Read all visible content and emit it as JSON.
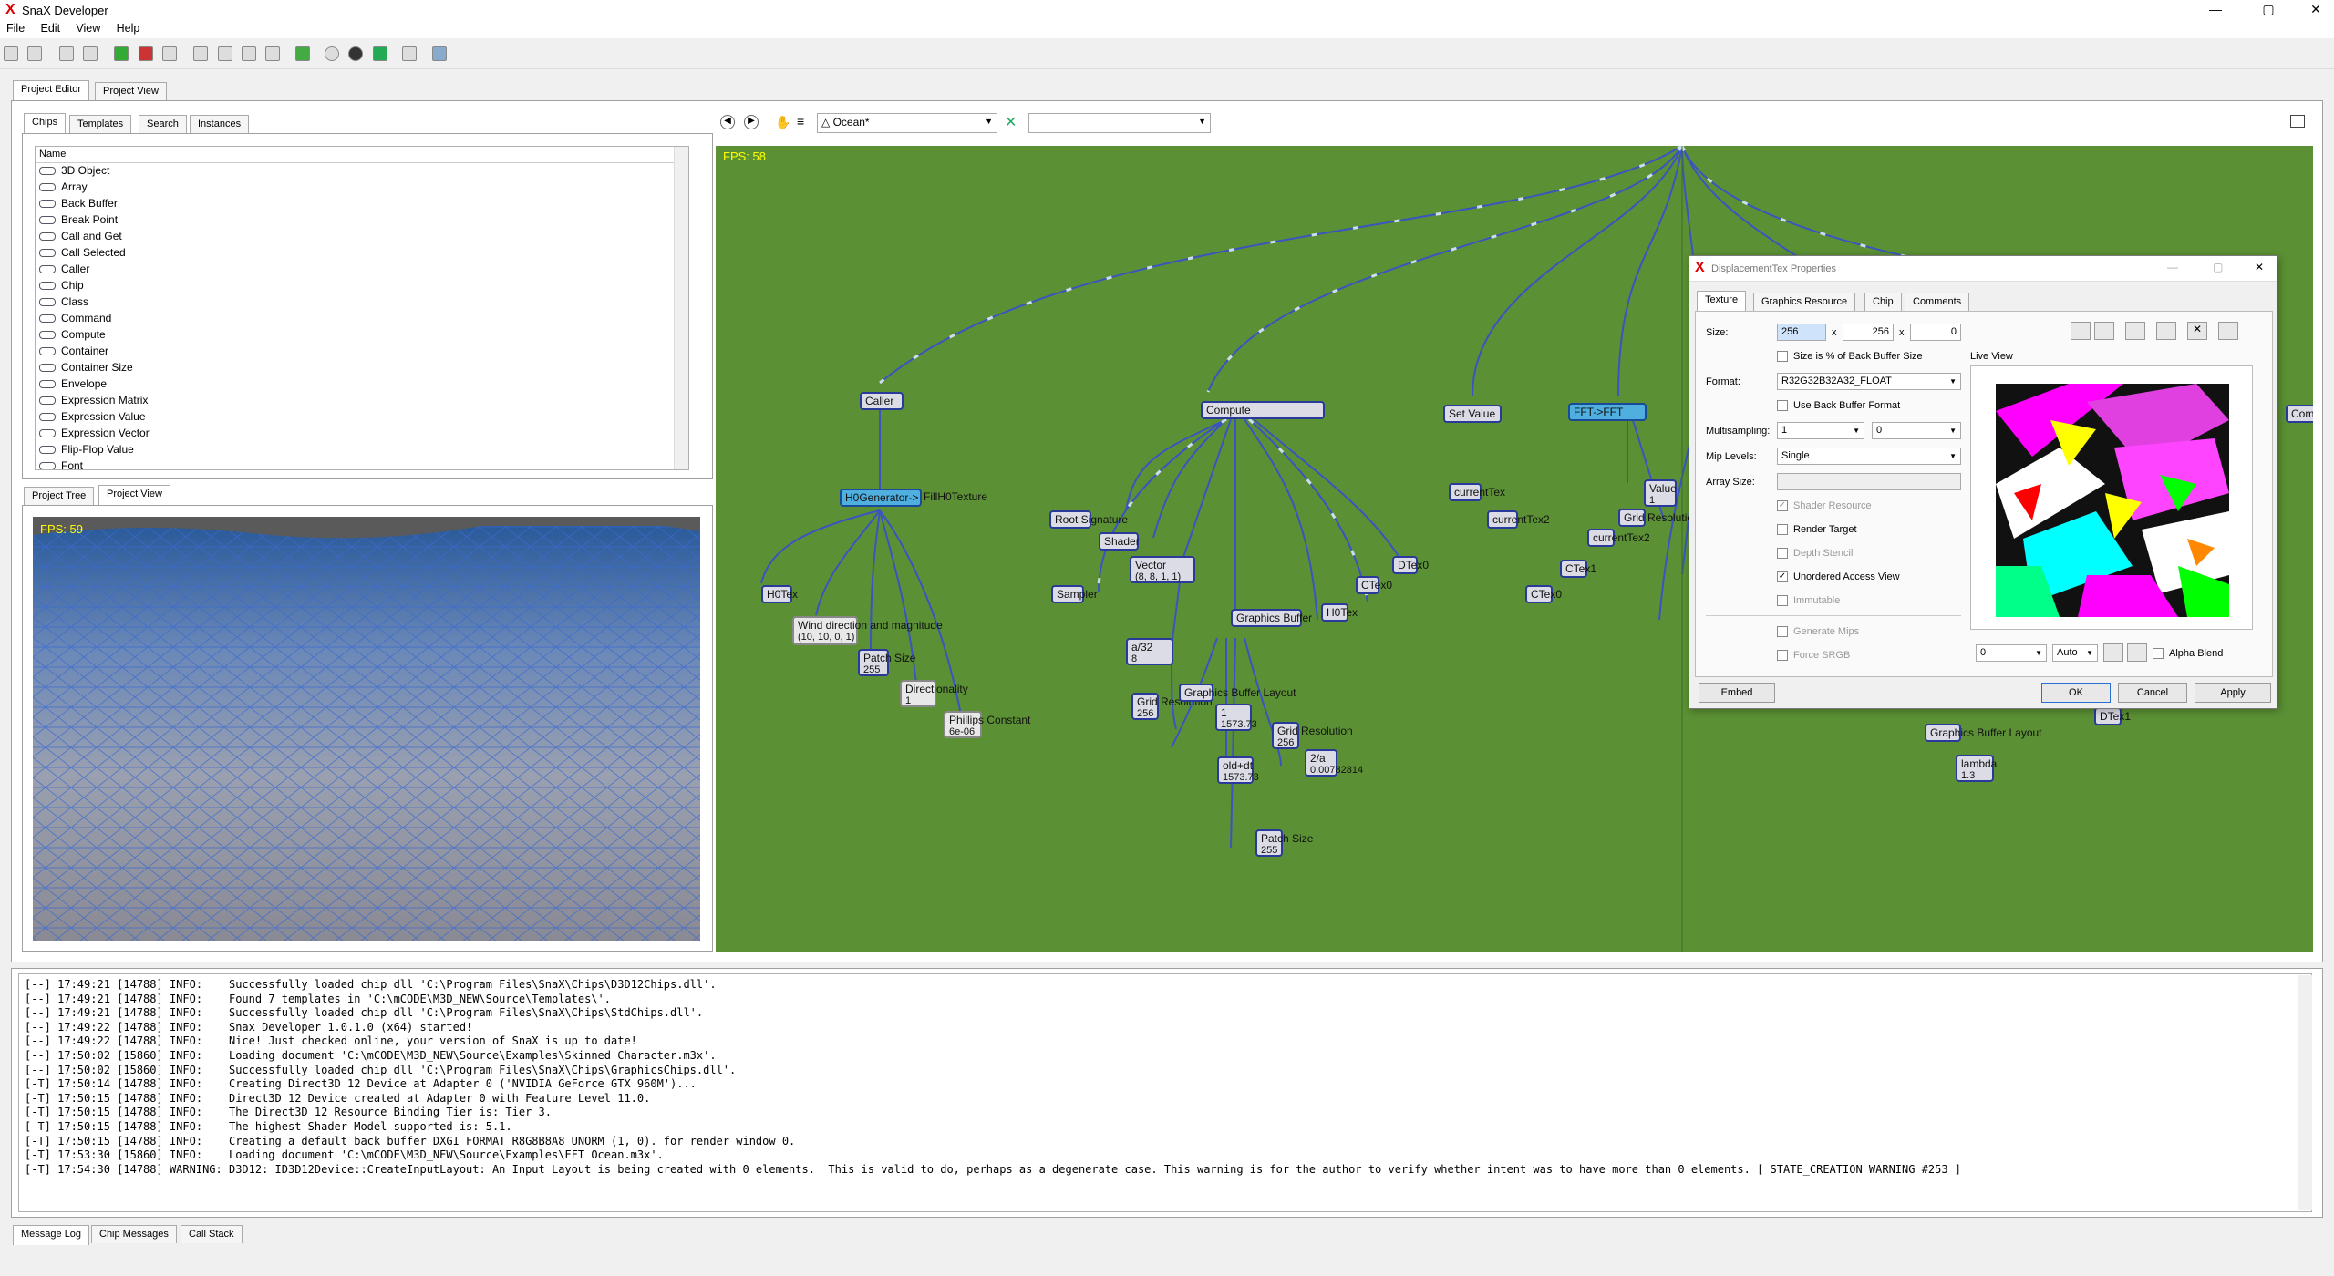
{
  "app": {
    "title": "SnaX Developer",
    "window_controls": [
      "—",
      "▢",
      "✕"
    ]
  },
  "menu": [
    "File",
    "Edit",
    "View",
    "Help"
  ],
  "main_tabs": [
    "Project Editor",
    "Project View"
  ],
  "chip_tabs": [
    "Chips",
    "Templates",
    "Search",
    "Instances"
  ],
  "chip_list": {
    "header": "Name",
    "items": [
      "3D Object",
      "Array",
      "Back Buffer",
      "Break Point",
      "Call and Get",
      "Call Selected",
      "Caller",
      "Chip",
      "Class",
      "Command",
      "Compute",
      "Container",
      "Container Size",
      "Envelope",
      "Expression Matrix",
      "Expression Value",
      "Expression Vector",
      "Flip-Flop Value",
      "Font"
    ]
  },
  "view_tabs": [
    "Project Tree",
    "Project View"
  ],
  "viewport_fps": "FPS: 59",
  "editor": {
    "document": "Ocean*",
    "second_combo": "",
    "fps": "FPS: 58"
  },
  "nodes": {
    "caller": "Caller",
    "compute": "Compute",
    "set_value": "Set Value",
    "fft": "FFT->FFT",
    "h0gen": "H0Generator->",
    "fill": "FillH0Texture",
    "h0tex": "H0Tex",
    "wind": "Wind direction and magnitude",
    "wind_val": "(10, 10, 0, 1)",
    "patch_size": "Patch Size",
    "patch_val": "255",
    "directionality": "Directionality",
    "dir_val": "1",
    "phillips": "Phillips Constant",
    "phillips_val": "6e-06",
    "root_sig": "Root Signature",
    "shader": "Shader",
    "sampler": "Sampler",
    "vector": "Vector",
    "vector_val": "(8, 8, 1, 1)",
    "a32": "a/32",
    "a32_val": "8",
    "grid_res": "Grid Resolution",
    "grid_val": "256",
    "gb_layout": "Graphics Buffer Layout",
    "graphics_buffer": "Graphics Buffer",
    "h0tex2": "H0Tex",
    "ctex0": "CTex0",
    "dtex0": "DTex0",
    "one": "1",
    "one_val": "1573.73",
    "old_dt": "old+dt",
    "old_dt_val": "1573.73",
    "grid_res2": "Grid Resolution",
    "grid_val2": "256",
    "two_a": "2/a",
    "two_a_val": "0.00782814",
    "patch2": "Patch Size",
    "patch2_val": "255",
    "current_tex": "currentTex",
    "current_tex2": "currentTex2",
    "ctex1": "CTex1",
    "ctex0b": "CTex0",
    "grid_res3": "Grid Resolution",
    "current_tex2b": "currentTex2",
    "value": "Value",
    "value_val": "1",
    "gb_layout2": "Graphics Buffer Layout",
    "lambda": "lambda",
    "lambda_val": "1.3",
    "dtex1": "DTex1",
    "com": "Com"
  },
  "dialog": {
    "title": "DisplacementTex Properties",
    "tabs": [
      "Texture",
      "Graphics Resource",
      "Chip",
      "Comments"
    ],
    "size_label": "Size:",
    "size_w": "256",
    "size_h": "256",
    "size_d": "0",
    "x": "x",
    "size_pct": "Size is % of Back Buffer Size",
    "format_label": "Format:",
    "format": "R32G32B32A32_FLOAT",
    "use_bb_format": "Use Back Buffer Format",
    "ms_label": "Multisampling:",
    "ms_count": "1",
    "ms_quality": "0",
    "mip_label": "Mip Levels:",
    "mip": "Single",
    "array_label": "Array Size:",
    "shader_resource": "Shader Resource",
    "render_target": "Render Target",
    "depth_stencil": "Depth Stencil",
    "uav": "Unordered Access View",
    "immutable": "Immutable",
    "generate_mips": "Generate Mips",
    "force_srgb": "Force SRGB",
    "live_view": "Live View",
    "lv_combo1": "0",
    "lv_combo2": "Auto",
    "alpha_blend": "Alpha Blend",
    "embed": "Embed",
    "ok": "OK",
    "cancel": "Cancel",
    "apply": "Apply"
  },
  "log": [
    "[--] 17:49:21 [14788] INFO:    Successfully loaded chip dll 'C:\\Program Files\\SnaX\\Chips\\D3D12Chips.dll'.",
    "[--] 17:49:21 [14788] INFO:    Found 7 templates in 'C:\\mCODE\\M3D_NEW\\Source\\Templates\\'.",
    "[--] 17:49:21 [14788] INFO:    Successfully loaded chip dll 'C:\\Program Files\\SnaX\\Chips\\StdChips.dll'.",
    "[--] 17:49:22 [14788] INFO:    Snax Developer 1.0.1.0 (x64) started!",
    "[--] 17:49:22 [14788] INFO:    Nice! Just checked online, your version of SnaX is up to date!",
    "[--] 17:50:02 [15860] INFO:    Loading document 'C:\\mCODE\\M3D_NEW\\Source\\Examples\\Skinned Character.m3x'.",
    "[--] 17:50:02 [15860] INFO:    Successfully loaded chip dll 'C:\\Program Files\\SnaX\\Chips\\GraphicsChips.dll'.",
    "[-T] 17:50:14 [14788] INFO:    Creating Direct3D 12 Device at Adapter 0 ('NVIDIA GeForce GTX 960M')...",
    "[-T] 17:50:15 [14788] INFO:    Direct3D 12 Device created at Adapter 0 with Feature Level 11.0.",
    "[-T] 17:50:15 [14788] INFO:    The Direct3D 12 Resource Binding Tier is: Tier 3.",
    "[-T] 17:50:15 [14788] INFO:    The highest Shader Model supported is: 5.1.",
    "[-T] 17:50:15 [14788] INFO:    Creating a default back buffer DXGI_FORMAT_R8G8B8A8_UNORM (1, 0). for render window 0.",
    "[-T] 17:53:30 [15860] INFO:    Loading document 'C:\\mCODE\\M3D_NEW\\Source\\Examples\\FFT Ocean.m3x'.",
    "[-T] 17:54:30 [14788] WARNING: D3D12: ID3D12Device::CreateInputLayout: An Input Layout is being created with 0 elements.  This is valid to do, perhaps as a degenerate case. This warning is for the author to verify whether intent was to have more than 0 elements. [ STATE_CREATION WARNING #253 ]"
  ],
  "bottom_tabs": [
    "Message Log",
    "Chip Messages",
    "Call Stack"
  ]
}
